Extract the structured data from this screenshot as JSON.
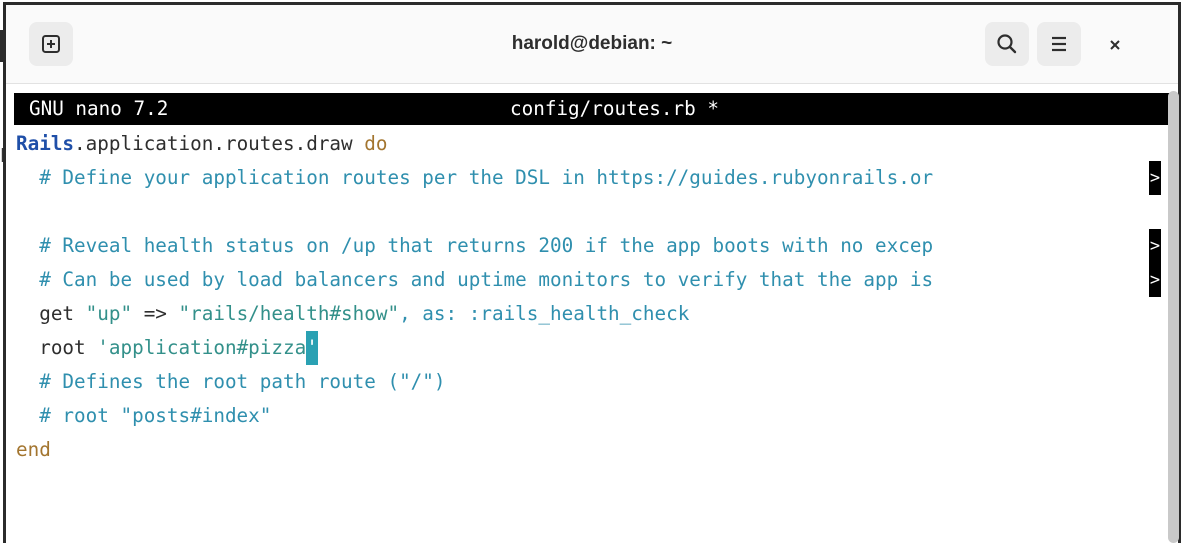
{
  "window": {
    "title": "harold@debian: ~",
    "new_tab_icon": "new-tab-icon",
    "search_icon": "search-icon",
    "menu_icon": "hamburger-menu-icon",
    "close_glyph": "×"
  },
  "nano": {
    "version": "GNU nano 7.2",
    "filename": "config/routes.rb *"
  },
  "editor": {
    "truncation_marker": ">",
    "lines": {
      "l1": {
        "a": "Rails",
        "b": ".application.routes.draw ",
        "c": "do"
      },
      "l2": {
        "text": "  # Define your application routes per the DSL in https://guides.rubyonrails.or"
      },
      "l4": {
        "text": "  # Reveal health status on /up that returns 200 if the app boots with no excep"
      },
      "l5": {
        "text": "  # Can be used by load balancers and uptime monitors to verify that the app is"
      },
      "l6": {
        "a": "  get ",
        "b": "\"up\"",
        "c": " => ",
        "d": "\"rails/health#show\"",
        "e": ", as: ",
        "f": ":rails_health_check"
      },
      "l7": {
        "a": "  root ",
        "b": "'application#pizza",
        "cursor": "'"
      },
      "l8": {
        "text": "  # Defines the root path route (\"/\")"
      },
      "l9": {
        "text": "  # root \"posts#index\""
      },
      "l10": {
        "text": "end"
      }
    }
  },
  "colors": {
    "header_bg": "#000000",
    "comment": "#2f8fae",
    "string": "#33908a",
    "keyword": "#a3752f",
    "class": "#1f4fa8",
    "cursor": "#2aa1b3"
  }
}
